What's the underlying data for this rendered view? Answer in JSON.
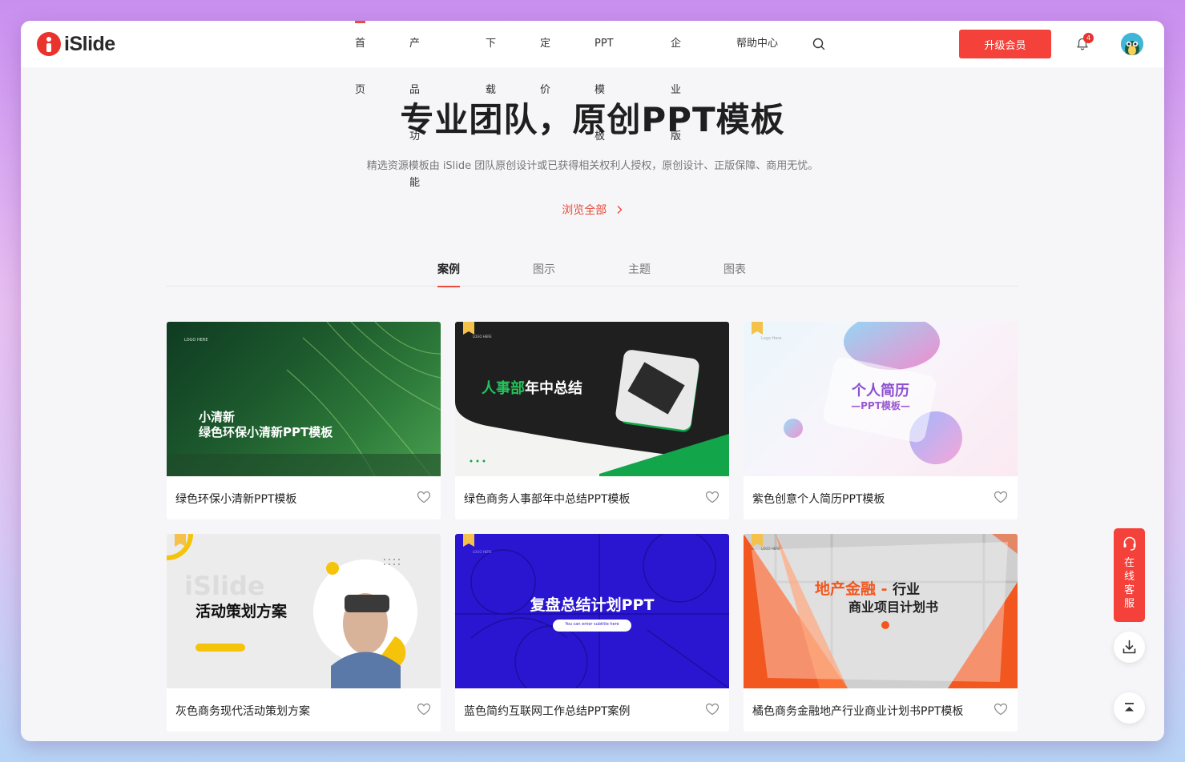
{
  "brand": {
    "name": "iSlide"
  },
  "nav": {
    "items": [
      "首页",
      "产品功能",
      "下载",
      "定价",
      "PPT 模板",
      "企业版",
      "帮助中心"
    ],
    "active": "首页"
  },
  "header": {
    "upgrade_label": "升级会员",
    "notification_count": "4"
  },
  "hero": {
    "title": "专业团队，原创PPT模板",
    "subtitle": "精选资源模板由 iSlide 团队原创设计或已获得相关权利人授权，原创设计、正版保障、商用无忧。",
    "browse_label": "浏览全部"
  },
  "tabs": {
    "items": [
      "案例",
      "图示",
      "主题",
      "图表"
    ],
    "active": "案例"
  },
  "cards": [
    {
      "title": "绿色环保小清新PPT模板",
      "thumb_line1": "小清新",
      "thumb_line2": "绿色环保小清新PPT模板",
      "logo_text": "LOGO HERE"
    },
    {
      "title": "绿色商务人事部年中总结PPT模板",
      "thumb_green": "人事部",
      "thumb_white": "年中总结",
      "logo_text": "LOGO HERE"
    },
    {
      "title": "紫色创意个人简历PPT模板",
      "thumb_line1": "个人简历",
      "thumb_line2": "—PPT模板—",
      "logo_text": "Logo Here"
    },
    {
      "title": "灰色商务现代活动策划方案",
      "thumb_line1": "活动策划方案",
      "thumb_watermark": "iSlide"
    },
    {
      "title": "蓝色简约互联网工作总结PPT案例",
      "thumb_line1": "复盘总结计划PPT",
      "thumb_pill": "You can enter subtitle here",
      "logo_text": "LOGO HERE"
    },
    {
      "title": "橘色商务金融地产行业商业计划书PPT模板",
      "thumb_orange": "地产金融 -",
      "thumb_dark": "行业",
      "thumb_line2": "商业项目计划书",
      "logo_text": "LOGO HERE"
    }
  ],
  "side": {
    "help_label": "在线客服"
  },
  "colors": {
    "accent": "#e94b3c",
    "upgrade": "#f4413a"
  }
}
